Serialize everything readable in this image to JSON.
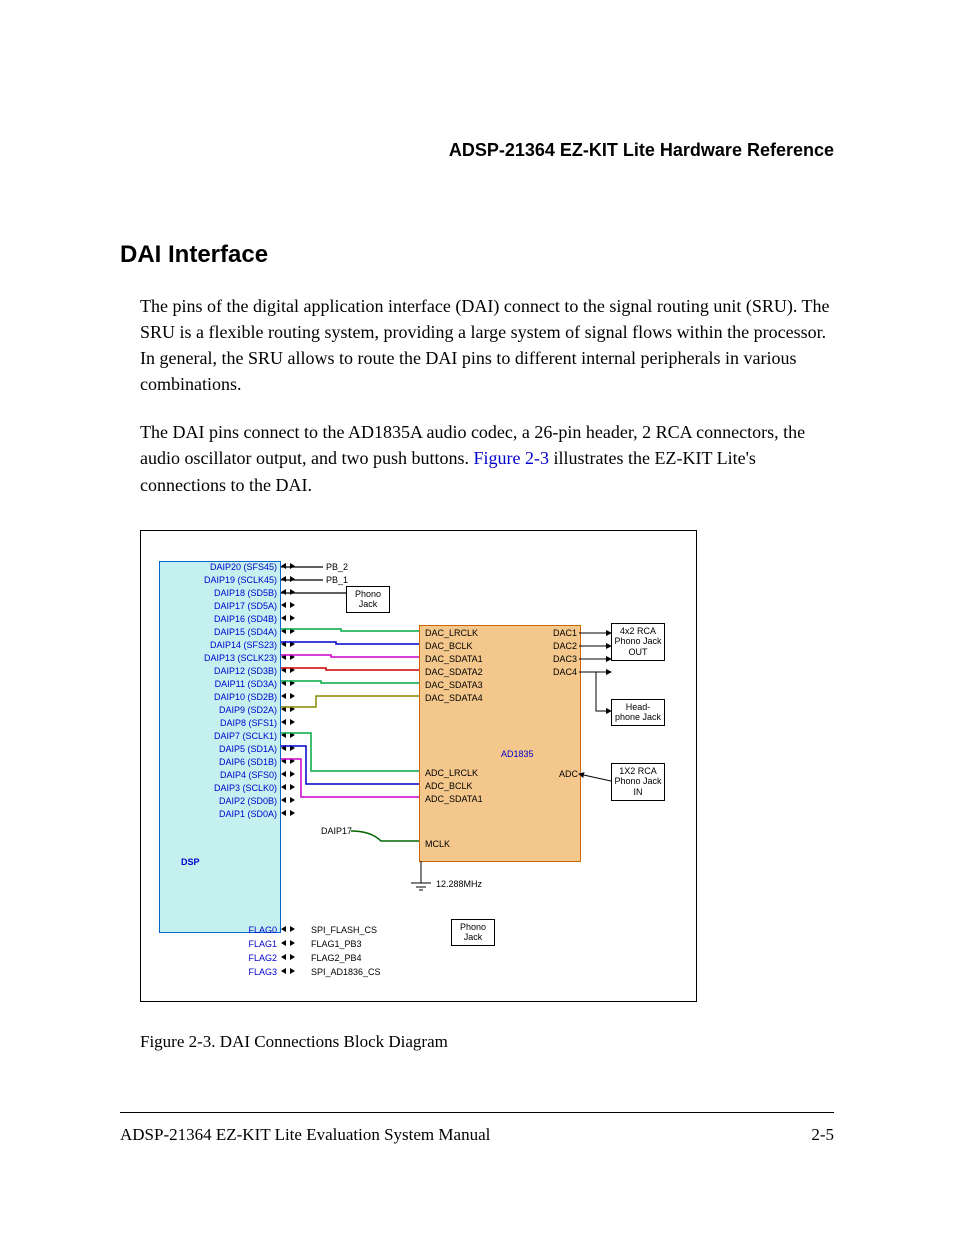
{
  "header": "ADSP-21364 EZ-KIT Lite Hardware Reference",
  "section_title": "DAI Interface",
  "para1": "The pins of the digital application interface (DAI) connect to the signal routing unit (SRU). The SRU is a flexible routing system, providing a large system of signal flows within the processor. In general, the SRU allows to route the DAI pins to different internal peripherals in various combinations.",
  "para2_a": "The DAI pins connect to the AD1835A audio codec, a 26-pin header, 2 RCA connectors, the audio oscillator output, and two push buttons. ",
  "para2_link": "Figure 2-3",
  "para2_b": " illustrates the EZ-KIT Lite's connections to the DAI.",
  "caption": "Figure 2-3. DAI Connections Block Diagram",
  "footer_left": "ADSP-21364 EZ-KIT Lite Evaluation System Manual",
  "footer_right": "2-5",
  "diagram": {
    "dsp_label": "DSP",
    "ad_label": "AD1835",
    "daip17_note": "DAIP17",
    "clock": "12.288MHz",
    "dsp_pins": [
      "DAIP20 (SFS45)",
      "DAIP19 (SCLK45)",
      "DAIP18 (SD5B)",
      "DAIP17 (SD5A)",
      "DAIP16 (SD4B)",
      "DAIP15 (SD4A)",
      "DAIP14 (SFS23)",
      "DAIP13 (SCLK23)",
      "DAIP12 (SD3B)",
      "DAIP11 (SD3A)",
      "DAIP10 (SD2B)",
      "DAIP9 (SD2A)",
      "DAIP8 (SFS1)",
      "DAIP7 (SCLK1)",
      "DAIP5 (SD1A)",
      "DAIP6 (SD1B)",
      "DAIP4 (SFS0)",
      "DAIP3 (SCLK0)",
      "DAIP2 (SD0B)",
      "DAIP1 (SD0A)"
    ],
    "flag_pins": [
      "FLAG0",
      "FLAG1",
      "FLAG2",
      "FLAG3"
    ],
    "flag_labels": [
      "SPI_FLASH_CS",
      "FLAG1_PB3",
      "FLAG2_PB4",
      "SPI_AD1836_CS"
    ],
    "pb_labels": [
      "PB_2",
      "PB_1"
    ],
    "dac_signals": [
      "DAC_LRCLK",
      "DAC_BCLK",
      "DAC_SDATA1",
      "DAC_SDATA2",
      "DAC_SDATA3",
      "DAC_SDATA4"
    ],
    "adc_signals": [
      "ADC_LRCLK",
      "ADC_BCLK",
      "ADC_SDATA1"
    ],
    "mclk": "MCLK",
    "dac_outs": [
      "DAC1",
      "DAC2",
      "DAC3",
      "DAC4"
    ],
    "adc_in": "ADC",
    "boxes": {
      "phono_top": "Phono\nJack",
      "rca_out": "4x2\nRCA\nPhono\nJack\nOUT",
      "headphone": "Head-\nphone\nJack",
      "rca_in": "1X2\nRCA\nPhono\nJack IN",
      "phono_bottom": "Phono\nJack"
    }
  }
}
